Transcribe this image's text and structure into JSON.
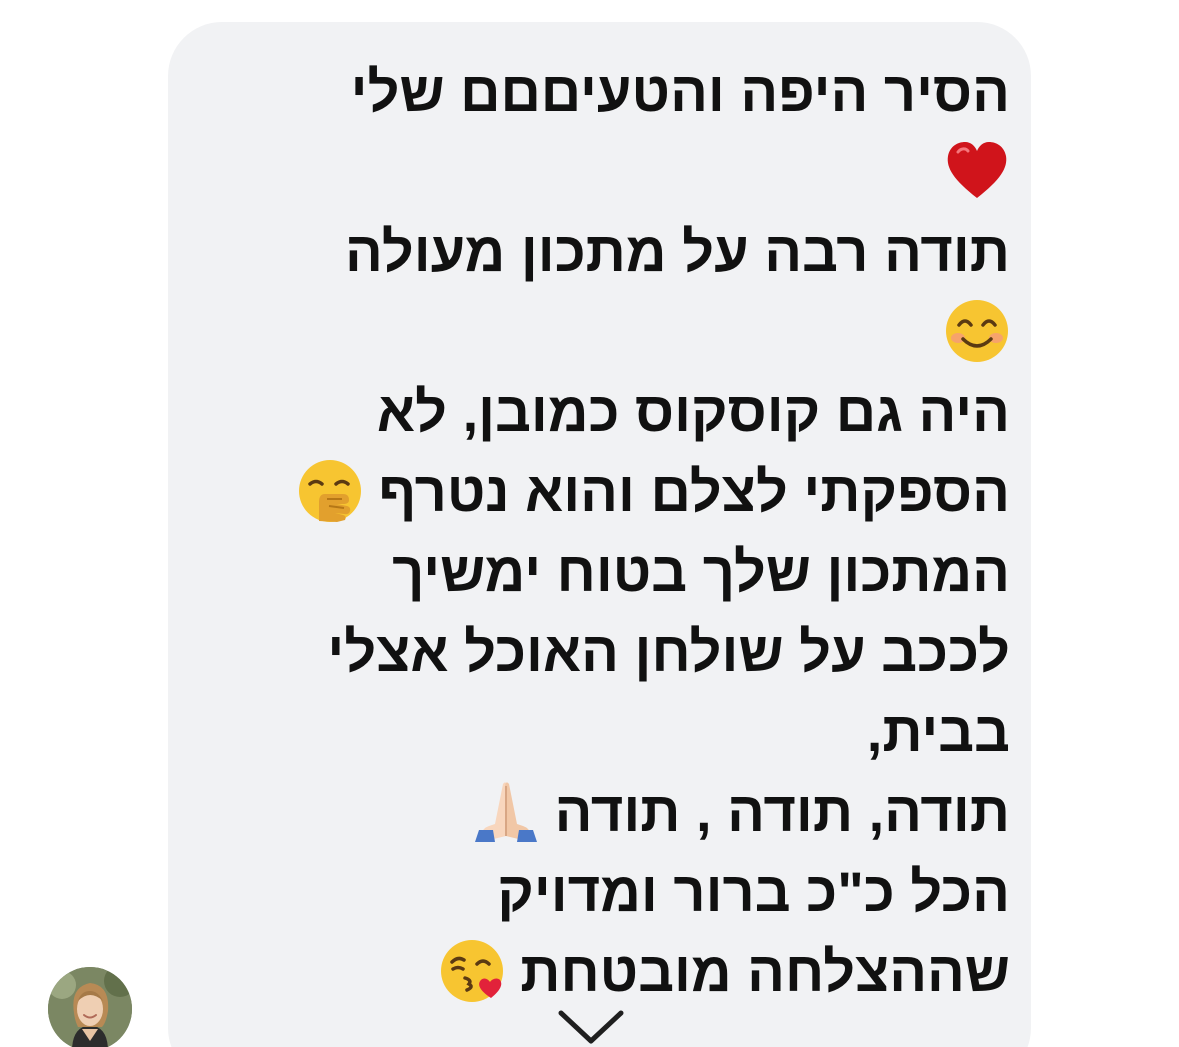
{
  "message": {
    "line_1": "הסיר היפה והטעיםםם שלי",
    "emoji_1": "red-heart",
    "line_2": "תודה רבה על מתכון מעולה",
    "emoji_2": "smiling-face-with-smiling-eyes",
    "line_3": "היה גם קוסקוס כמובן, לא",
    "line_4": "הספקתי לצלם והוא נטרף",
    "emoji_4": "face-with-hand-over-mouth",
    "line_5": "המתכון שלך בטוח ימשיך",
    "line_6": "לככב על שולחן האוכל אצלי",
    "line_7": "בבית,",
    "line_8": "תודה, תודה , תודה",
    "emoji_8": "folded-hands",
    "line_9": "הכל כ\"כ ברור ומדויק",
    "line_10": "שההצלחה מובטחת",
    "emoji_10": "face-blowing-a-kiss"
  },
  "icons": {
    "scroll": "chevron-down-icon",
    "avatar": "user-avatar"
  },
  "colors": {
    "bubble_background": "#f1f2f4",
    "text": "#111111",
    "heart": "#d0141b",
    "emoji_yellow": "#f7c531"
  }
}
